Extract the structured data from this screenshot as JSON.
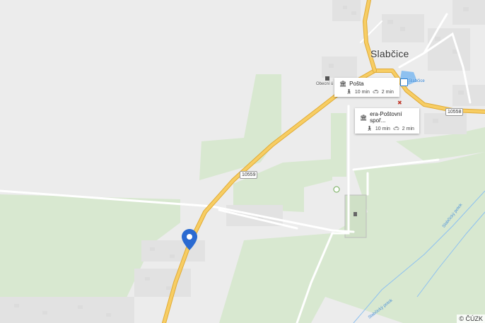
{
  "map": {
    "town_label": "Slabčice",
    "road_numbers": [
      "10559",
      "10558"
    ],
    "poi_labels": {
      "municipal_office": "Obecní ú",
      "bus_stop": "Slabčice"
    },
    "stream_labels": [
      "Slabčický potok",
      "Slabčický potok"
    ],
    "copyright": "© ČÚZK"
  },
  "popups": [
    {
      "title": "Pošta",
      "walk_time": "10 min",
      "drive_time": "2 min"
    },
    {
      "title": "era-Poštovní spoř...",
      "walk_time": "10 min",
      "drive_time": "2 min"
    }
  ],
  "colors": {
    "background": "#ececec",
    "forest": "#d8e8d0",
    "main_road": "#f2c04e",
    "marker": "#2a6ad1",
    "water": "#8ec1f0"
  },
  "icons": {
    "popup_title": "building-icon",
    "walk": "walk-icon",
    "drive": "car-icon",
    "marker": "location-pin-icon"
  }
}
